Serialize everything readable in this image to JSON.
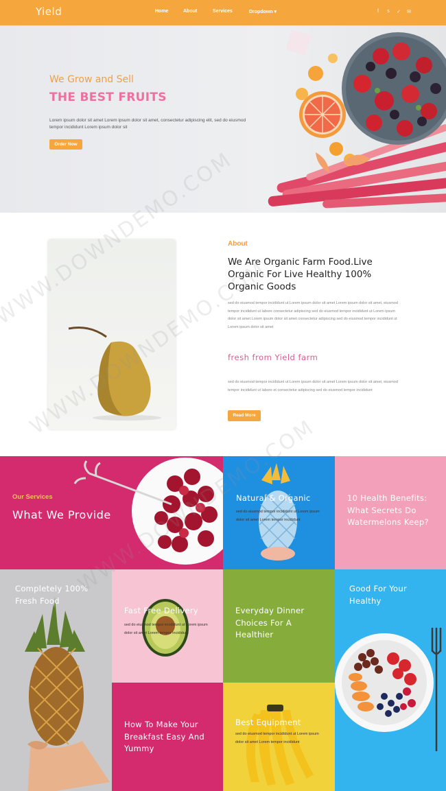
{
  "nav": {
    "brand": "Yield",
    "menu": [
      "Home",
      "About",
      "Services",
      "Dropdown ▾"
    ],
    "social_icons": [
      "facebook-icon",
      "skype-icon",
      "twitter-icon",
      "mail-icon"
    ]
  },
  "hero": {
    "subtitle": "We Grow and Sell",
    "title": "THE BEST FRUITS",
    "text": "Lorem ipsum dolor sit amet Lorem ipsum dolor sit amet, consectetur adipiscing elit, sed do eiusmod tempor incididunt Lorem ipsum dolor sit",
    "button": "Order Now"
  },
  "about": {
    "label": "About",
    "title": "We Are Organic Farm Food.Live Organic For Live Healthy 100% Organic Goods",
    "paragraph1": "sed do eiusmod tempor incididunt ut Lorem ipsum dolor sit amet Lorem ipsum dolor sit amet, eiusmod tempor incididunt ut labore consectetur adipiscing sed do eiusmod tempor incididunt ut Lorem ipsum dolor sit amet Lorem ipsum dolor sit amet consectetur adipiscing sed do eiusmod tempor incididunt ut Lorem ipsum dolor sit amet",
    "subtitle": "fresh from Yield farm",
    "paragraph2": "sed do eiusmod tempor incididunt ut Lorem ipsum dolor sit amet Lorem ipsum dolor sit amet, eiusmod tempor incididunt ut labore et consectetur adipiscing sed do eiusmod tempor incididunt",
    "button": "Read More"
  },
  "services": {
    "label": "Our Services",
    "title": "What We Provide",
    "tiles": [
      {
        "title": "Natural & Organic",
        "text": "sed do eiusmod tempor incididunt ut Lorem ipsum dolor sit amet Lorem tempor incididunt"
      },
      {
        "title": "10 Health Benefits: What Secrets Do Watermelons Keep?",
        "text": ""
      },
      {
        "title": "Completely 100% Fresh Food",
        "text": ""
      },
      {
        "title": "Fast Free Delivery",
        "text": "sed do eiusmod tempor incididunt ut Lorem ipsum dolor sit amet Lorem tempor incididunt"
      },
      {
        "title": "Everyday Dinner Choices For A Healthier",
        "text": ""
      },
      {
        "title": "Good For Your Healthy",
        "text": ""
      },
      {
        "title": "How To Make Your Breakfast Easy And Yummy",
        "text": ""
      },
      {
        "title": "Best Equipment",
        "text": "sed do eiusmod tempor incididunt ut Lorem ipsum dolor sit amet Lorem tempor incididunt"
      }
    ]
  },
  "colors": {
    "accent": "#f5a63c",
    "pink": "#d42a6e",
    "blue": "#1f8fe0",
    "light_pink": "#f3a0ba",
    "green": "#86ad3c",
    "yellow": "#f2d23a",
    "sky": "#33b4ee"
  },
  "watermark": "WWW.DOWNDEMO.COM"
}
